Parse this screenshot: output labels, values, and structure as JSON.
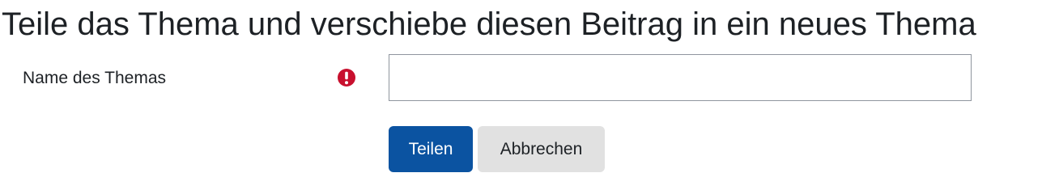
{
  "page": {
    "title": "Teile das Thema und verschiebe diesen Beitrag in ein neues Thema"
  },
  "form": {
    "topic_name": {
      "label": "Name des Themas",
      "value": "",
      "placeholder": "",
      "required_icon": "exclamation-circle-icon"
    },
    "submit_label": "Teilen",
    "cancel_label": "Abbrechen"
  },
  "colors": {
    "primary_button": "#0b53a1",
    "secondary_button": "#e1e1e1",
    "required_icon": "#c8102e"
  }
}
